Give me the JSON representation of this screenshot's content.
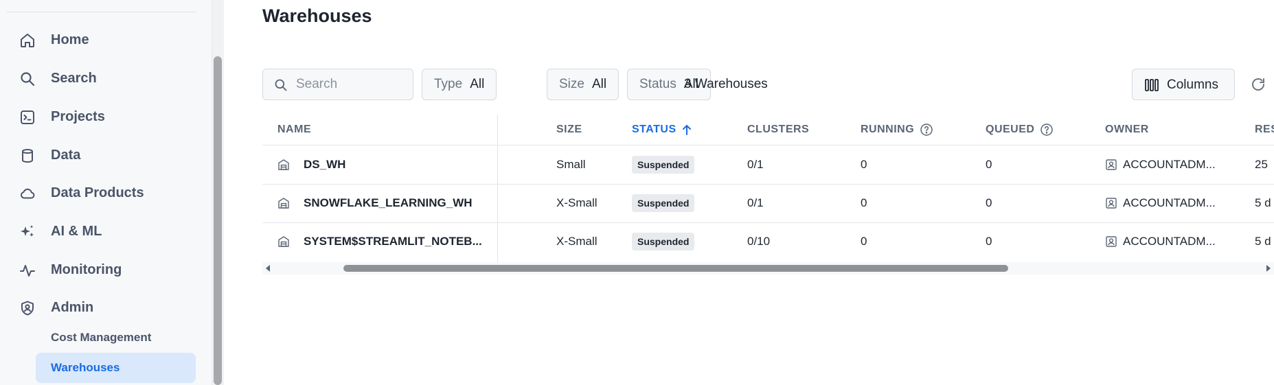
{
  "sidebar": {
    "items": [
      {
        "label": "Home",
        "icon": "home-icon"
      },
      {
        "label": "Search",
        "icon": "search-icon"
      },
      {
        "label": "Projects",
        "icon": "terminal-icon"
      },
      {
        "label": "Data",
        "icon": "database-icon"
      },
      {
        "label": "Data Products",
        "icon": "cloud-icon"
      },
      {
        "label": "AI & ML",
        "icon": "sparkle-icon"
      },
      {
        "label": "Monitoring",
        "icon": "activity-icon"
      },
      {
        "label": "Admin",
        "icon": "shield-user-icon"
      }
    ],
    "sub_items": [
      {
        "label": "Cost Management",
        "active": false
      },
      {
        "label": "Warehouses",
        "active": true
      }
    ]
  },
  "page": {
    "title": "Warehouses"
  },
  "filters": {
    "search_placeholder": "Search",
    "type": {
      "key": "Type",
      "value": "All"
    },
    "size": {
      "key": "Size",
      "value": "All"
    },
    "status": {
      "key": "Status",
      "value": "All"
    },
    "count_text": "3 Warehouses",
    "columns_label": "Columns"
  },
  "table": {
    "headers": {
      "name": "NAME",
      "size": "SIZE",
      "status": "STATUS",
      "clusters": "CLUSTERS",
      "running": "RUNNING",
      "queued": "QUEUED",
      "owner": "OWNER",
      "resumed": "RES"
    },
    "sort": {
      "column": "status",
      "direction": "ascending"
    },
    "rows": [
      {
        "name": "DS_WH",
        "size": "Small",
        "status": "Suspended",
        "clusters": "0/1",
        "running": "0",
        "queued": "0",
        "owner": "ACCOUNTADM...",
        "resumed": "25"
      },
      {
        "name": "SNOWFLAKE_LEARNING_WH",
        "size": "X-Small",
        "status": "Suspended",
        "clusters": "0/1",
        "running": "0",
        "queued": "0",
        "owner": "ACCOUNTADM...",
        "resumed": "5 d"
      },
      {
        "name": "SYSTEM$STREAMLIT_NOTEB...",
        "size": "X-Small",
        "status": "Suspended",
        "clusters": "0/10",
        "running": "0",
        "queued": "0",
        "owner": "ACCOUNTADM...",
        "resumed": "5 d"
      }
    ]
  },
  "colors": {
    "accent": "#1a6ce0",
    "active_bg": "#d9e8fb",
    "sidebar_bg": "#f7f8fa"
  }
}
